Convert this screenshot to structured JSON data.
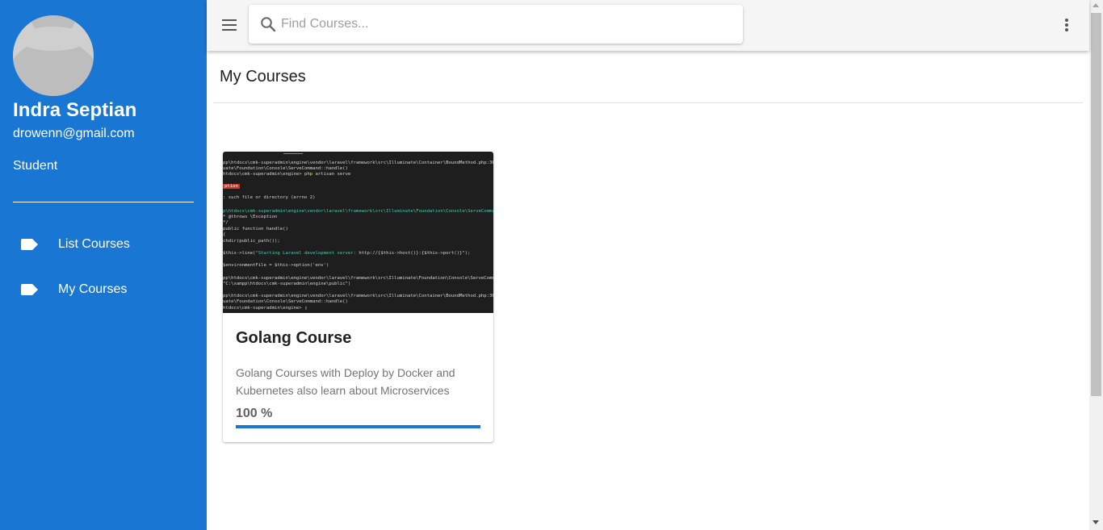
{
  "colors": {
    "primary": "#1976d2",
    "topbar": "#f5f5f5"
  },
  "sidebar": {
    "user": {
      "name": "Indra Septian",
      "email": "drowenn@gmail.com",
      "role": "Student"
    },
    "items": [
      {
        "label": "List Courses",
        "icon": "label-icon"
      },
      {
        "label": "My Courses",
        "icon": "label-icon"
      }
    ]
  },
  "topbar": {
    "search": {
      "placeholder": "Find Courses...",
      "value": ""
    }
  },
  "main": {
    "title": "My Courses",
    "courses": [
      {
        "title": "Golang Course",
        "description": "Golang Courses with Deploy by Docker and Kubernetes also learn about Microservices",
        "progress_text": "100 %",
        "progress": 1.0
      }
    ]
  }
}
